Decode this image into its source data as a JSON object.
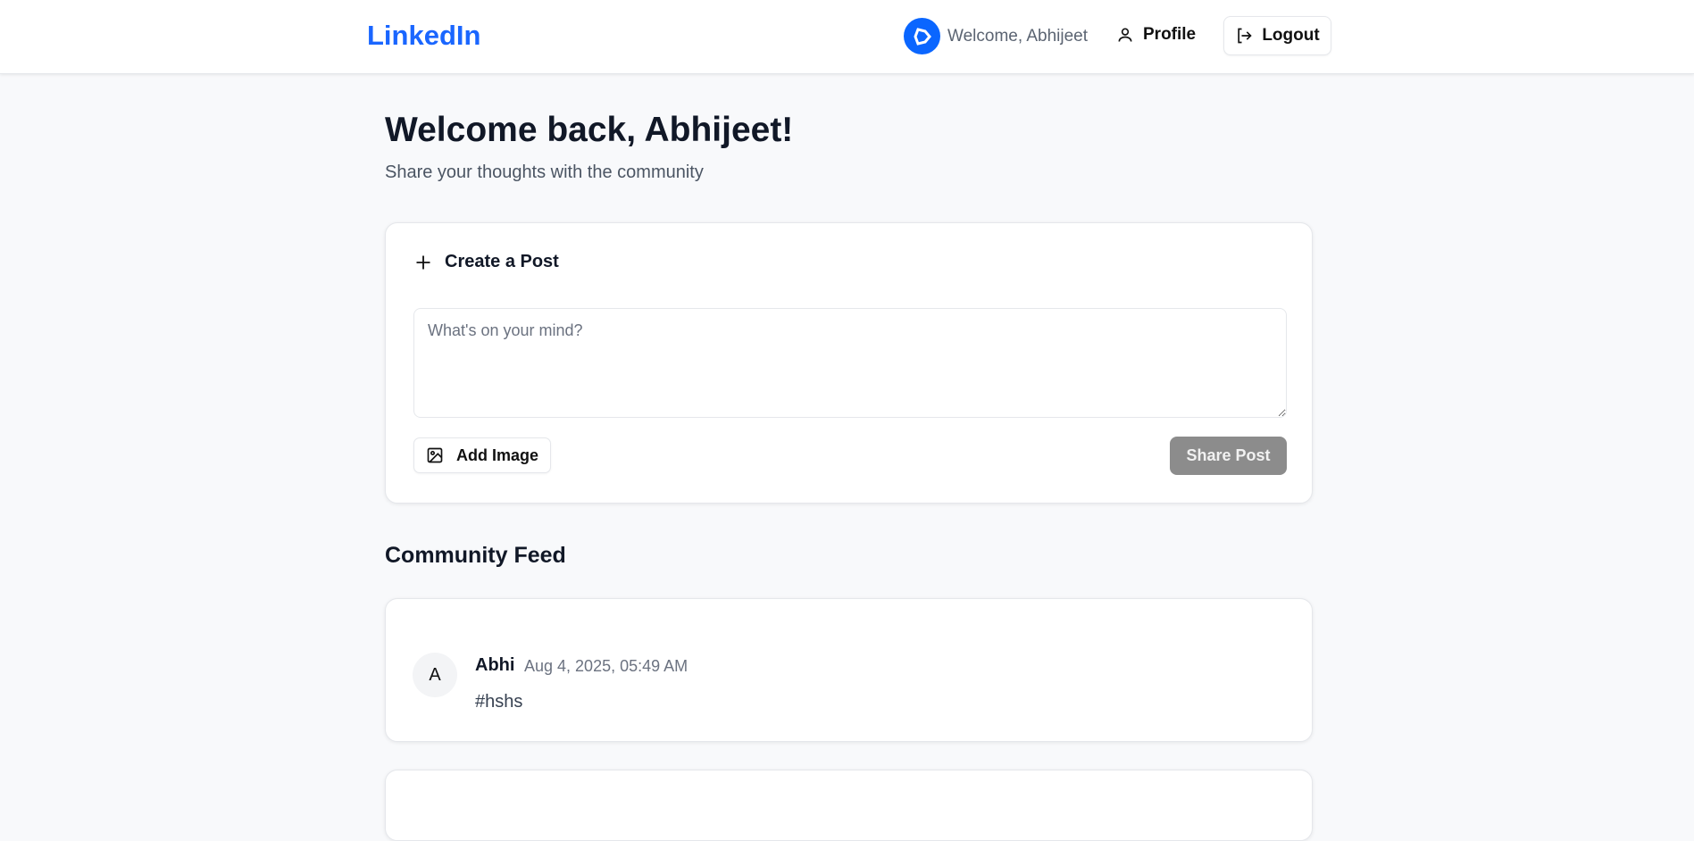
{
  "header": {
    "logo": "LinkedIn",
    "welcome": "Welcome, Abhijeet",
    "profile_label": "Profile",
    "logout_label": "Logout",
    "brand_color": "#0a66ff"
  },
  "main": {
    "title": "Welcome back, Abhijeet!",
    "subtitle": "Share your thoughts with the community"
  },
  "create_post": {
    "title": "Create a Post",
    "placeholder": "What's on your mind?",
    "value": "",
    "add_image_label": "Add Image",
    "share_label": "Share Post"
  },
  "feed": {
    "title": "Community Feed",
    "posts": [
      {
        "avatar_initial": "A",
        "author": "Abhi",
        "date": "Aug 4, 2025, 05:49 AM",
        "content": "#hshs"
      }
    ]
  }
}
